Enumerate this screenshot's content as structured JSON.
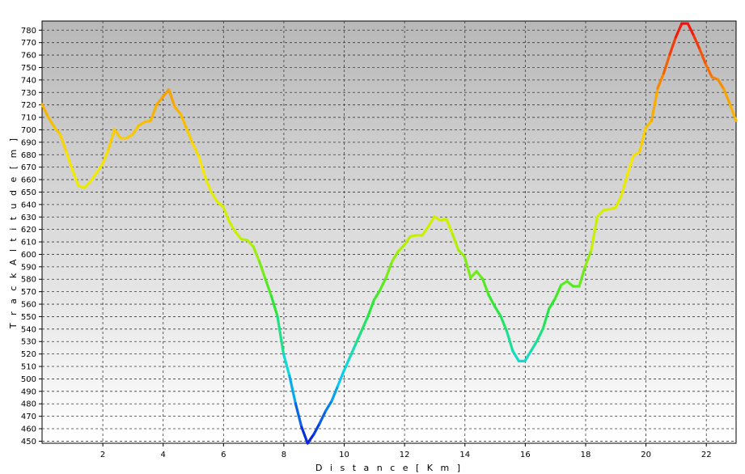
{
  "chart_data": {
    "type": "line",
    "title": "",
    "xlabel": "D i s t a n c e   [ K m ]",
    "ylabel": "T r a c k   A l t i t u d e   [ m ]",
    "xlim": [
      0,
      23
    ],
    "ylim": [
      448,
      787
    ],
    "x_ticks": [
      2,
      4,
      6,
      8,
      10,
      12,
      14,
      16,
      18,
      20,
      22
    ],
    "x_tick_labels": [
      "2",
      "4",
      "6",
      "8",
      "10",
      "12",
      "14",
      "16",
      "18",
      "20",
      "22"
    ],
    "y_ticks": [
      450,
      460,
      470,
      480,
      490,
      500,
      510,
      520,
      530,
      540,
      550,
      560,
      570,
      580,
      590,
      600,
      610,
      620,
      630,
      640,
      650,
      660,
      670,
      680,
      690,
      700,
      710,
      720,
      730,
      740,
      750,
      760,
      770,
      780
    ],
    "y_tick_labels": [
      "450",
      "460",
      "470",
      "480",
      "490",
      "500",
      "510",
      "520",
      "530",
      "540",
      "550",
      "560",
      "570",
      "580",
      "590",
      "600",
      "610",
      "620",
      "630",
      "640",
      "650",
      "660",
      "670",
      "680",
      "690",
      "700",
      "710",
      "720",
      "730",
      "740",
      "750",
      "760",
      "770",
      "780"
    ],
    "grid": true,
    "legend": "none",
    "color_scale": {
      "by": "altitude",
      "low_color": "#0a18d8",
      "high_color": "#ee0e0e",
      "stops": [
        "#0a18d8",
        "#0ad8f0",
        "#2ee82e",
        "#c8f000",
        "#f8e800",
        "#f8a000",
        "#ee0e0e"
      ]
    },
    "background_gradient": [
      "#b8b8b8",
      "#ffffff"
    ],
    "series": [
      {
        "x": [
          0,
          0.2,
          0.4,
          0.6,
          0.8,
          1.0,
          1.2,
          1.4,
          1.6,
          1.8,
          2.0,
          2.2,
          2.4,
          2.6,
          2.8,
          3.0,
          3.2,
          3.4,
          3.6,
          3.8,
          4.0,
          4.2,
          4.4,
          4.6,
          4.8,
          5.0,
          5.2,
          5.4,
          5.6,
          5.8,
          6.0,
          6.2,
          6.4,
          6.6,
          6.8,
          7.0,
          7.2,
          7.4,
          7.6,
          7.8,
          8.0,
          8.2,
          8.4,
          8.6,
          8.8,
          9.0,
          9.2,
          9.4,
          9.6,
          9.8,
          10.0,
          10.2,
          10.4,
          10.6,
          10.8,
          11.0,
          11.2,
          11.4,
          11.6,
          11.8,
          12.0,
          12.2,
          12.4,
          12.6,
          12.8,
          13.0,
          13.2,
          13.4,
          13.6,
          13.8,
          14.0,
          14.2,
          14.4,
          14.6,
          14.8,
          15.0,
          15.2,
          15.4,
          15.6,
          15.8,
          16.0,
          16.2,
          16.4,
          16.6,
          16.8,
          17.0,
          17.2,
          17.4,
          17.6,
          17.8,
          18.0,
          18.2,
          18.4,
          18.6,
          18.8,
          19.0,
          19.2,
          19.4,
          19.6,
          19.8,
          20.0,
          20.2,
          20.4,
          20.6,
          20.8,
          21.0,
          21.2,
          21.4,
          21.6,
          21.8,
          22.0,
          22.2,
          22.4,
          22.6,
          22.8,
          23.0
        ],
        "y": [
          720,
          710,
          702,
          696,
          682,
          668,
          655,
          653,
          658,
          665,
          672,
          684,
          700,
          693,
          693,
          696,
          703,
          706,
          707,
          720,
          726,
          732,
          718,
          712,
          700,
          688,
          678,
          662,
          650,
          642,
          638,
          626,
          618,
          612,
          611,
          606,
          594,
          580,
          566,
          550,
          520,
          502,
          480,
          461,
          448,
          455,
          464,
          474,
          482,
          494,
          506,
          517,
          528,
          539,
          550,
          563,
          571,
          581,
          594,
          602,
          607,
          614,
          615,
          615,
          622,
          630,
          627,
          628,
          616,
          603,
          598,
          581,
          586,
          580,
          567,
          558,
          550,
          538,
          522,
          514,
          514,
          522,
          530,
          540,
          556,
          564,
          575,
          578,
          574,
          574,
          590,
          603,
          630,
          635,
          636,
          637,
          647,
          664,
          679,
          682,
          701,
          707,
          733,
          745,
          760,
          774,
          785,
          785,
          775,
          764,
          752,
          742,
          740,
          732,
          720,
          707
        ]
      }
    ]
  }
}
